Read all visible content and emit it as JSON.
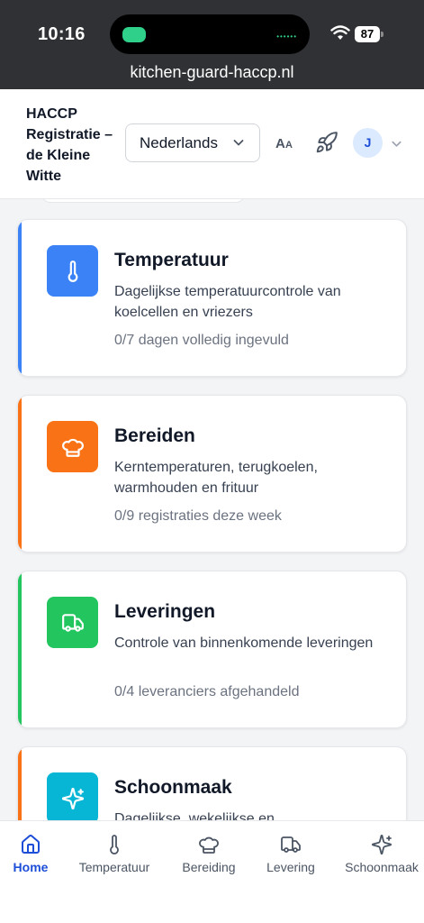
{
  "status": {
    "time": "10:16",
    "battery": "87",
    "url": "kitchen-guard-haccp.nl"
  },
  "header": {
    "title": "HACCP Registratie – de Kleine Witte",
    "language": "Nederlands",
    "avatar": "J"
  },
  "cards": [
    {
      "title": "Temperatuur",
      "description": "Dagelijkse temperatuurcontrole van koelcellen en vriezers",
      "meta": "0/7 dagen volledig ingevuld",
      "color": "#3b82f6"
    },
    {
      "title": "Bereiden",
      "description": "Kerntemperaturen, terugkoelen, warmhouden en frituur",
      "meta": "0/9 registraties deze week",
      "color": "#f97316"
    },
    {
      "title": "Leveringen",
      "description": "Controle van binnenkomende leveringen",
      "meta": "0/4 leveranciers afgehandeld",
      "color": "#22c55e"
    },
    {
      "title": "Schoonmaak",
      "description": "Dagelijkse, wekelijkse en",
      "meta": "",
      "color": "#06b6d4"
    }
  ],
  "tabs": [
    {
      "label": "Home",
      "icon": "home-icon"
    },
    {
      "label": "Temperatuur",
      "icon": "thermometer-icon"
    },
    {
      "label": "Bereiding",
      "icon": "chef-hat-icon"
    },
    {
      "label": "Levering",
      "icon": "truck-icon"
    },
    {
      "label": "Schoonmaak",
      "icon": "sparkles-icon"
    }
  ]
}
